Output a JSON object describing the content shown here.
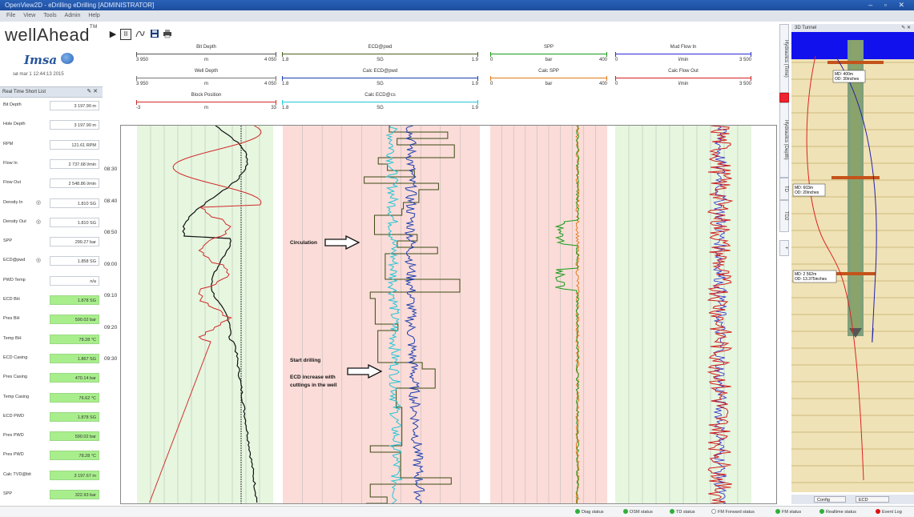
{
  "window": {
    "title": "OpenView2D - eDrilling eDrilling [ADMINISTRATOR]"
  },
  "menu": [
    "File",
    "View",
    "Tools",
    "Admin",
    "Help"
  ],
  "logo": {
    "text": "wellAhead",
    "mark": "TM"
  },
  "brand": {
    "text": "Imsa",
    "icon": "water-drop-icon"
  },
  "timestamp": "sø mar 1 12:44:13 2015",
  "short_list": {
    "title": "Real Time Short List",
    "items": [
      {
        "label": "Bit Depth",
        "value": "3 197.90 m",
        "green": false,
        "gauge": false
      },
      {
        "label": "Hole Depth",
        "value": "3 197.90 m",
        "green": false,
        "gauge": false
      },
      {
        "label": "RPM",
        "value": "121.61 RPM",
        "green": false,
        "gauge": false
      },
      {
        "label": "Flow In",
        "value": "2 737.68 l/min",
        "green": false,
        "gauge": false
      },
      {
        "label": "Flow Out",
        "value": "2 548.86 l/min",
        "green": false,
        "gauge": false
      },
      {
        "label": "Density In",
        "value": "1.810 SG",
        "green": false,
        "gauge": true
      },
      {
        "label": "Density Out",
        "value": "1.810 SG",
        "green": false,
        "gauge": true
      },
      {
        "label": "SPP",
        "value": "299.27 bar",
        "green": false,
        "gauge": false
      },
      {
        "label": "ECD@pwd",
        "value": "1.858 SG",
        "green": false,
        "gauge": true
      },
      {
        "label": "PWD Temp",
        "value": "n/a",
        "green": false,
        "gauge": false
      },
      {
        "label": "ECD BH",
        "value": "1.878 SG",
        "green": true,
        "gauge": false
      },
      {
        "label": "Pres BH",
        "value": "590.02 bar",
        "green": true,
        "gauge": false
      },
      {
        "label": "Temp BH",
        "value": "78.28 °C",
        "green": true,
        "gauge": false
      },
      {
        "label": "ECD Casing",
        "value": "1.867 SG",
        "green": true,
        "gauge": false
      },
      {
        "label": "Pres Casing",
        "value": "470.14 bar",
        "green": true,
        "gauge": false
      },
      {
        "label": "Temp Casing",
        "value": "76.62 °C",
        "green": true,
        "gauge": false
      },
      {
        "label": "ECD PWD",
        "value": "1.878 SG",
        "green": true,
        "gauge": false
      },
      {
        "label": "Pres PWD",
        "value": "590.02 bar",
        "green": true,
        "gauge": false
      },
      {
        "label": "Pres PWD",
        "value": "78.28 °C",
        "green": true,
        "gauge": false
      },
      {
        "label": "Calc TVD@bit",
        "value": "3 197.67 m",
        "green": true,
        "gauge": false
      },
      {
        "label": "SPP",
        "value": "322.93 bar",
        "green": true,
        "gauge": false
      }
    ]
  },
  "toolbar": {
    "play": "▶",
    "pause": "II"
  },
  "track_headers": [
    {
      "title": "Bit Depth",
      "min": "3 950",
      "unit": "m",
      "max": "4 050",
      "color": "#555555",
      "dashed": false
    },
    {
      "title": "Well Depth",
      "min": "3 950",
      "unit": "m",
      "max": "4 050",
      "color": "#777777",
      "dashed": true
    },
    {
      "title": "Block Position",
      "min": "-3",
      "unit": "m",
      "max": "33",
      "color": "#d22b2b",
      "dashed": false
    },
    {
      "title": "ECD@pwd",
      "min": "1.8",
      "unit": "SG",
      "max": "1.9",
      "color": "#4b5e1f",
      "dashed": false
    },
    {
      "title": "Calc ECD@pwd",
      "min": "1.8",
      "unit": "SG",
      "max": "1.9",
      "color": "#1c3fb0",
      "dashed": true
    },
    {
      "title": "Calc ECD@cs",
      "min": "1.8",
      "unit": "SG",
      "max": "1.9",
      "color": "#22c6d6",
      "dashed": true
    },
    {
      "title": "SPP",
      "min": "0",
      "unit": "bar",
      "max": "400",
      "color": "#1a9a1a",
      "dashed": false
    },
    {
      "title": "Calc SPP",
      "min": "0",
      "unit": "bar",
      "max": "400",
      "color": "#e07a1a",
      "dashed": false
    },
    {
      "title": "Mud Flow In",
      "min": "0",
      "unit": "l/min",
      "max": "3 500",
      "color": "#2a2ad0",
      "dashed": false
    },
    {
      "title": "Calc Flow Out",
      "min": "0",
      "unit": "l/min",
      "max": "3 500",
      "color": "#d02020",
      "dashed": false
    }
  ],
  "time_ticks": [
    "08:30",
    "08:40",
    "08:50",
    "09:00",
    "09:10",
    "09:20",
    "09:30"
  ],
  "annotations": {
    "circulation": "Circulation",
    "start_drilling": "Start drilling",
    "ecd_increase_1": "ECD increase with",
    "ecd_increase_2": "cuttings in the well"
  },
  "side_tabs": [
    "Hydraulics (Time)",
    "Hydraulics (Depth)",
    "TD",
    "TD2",
    "+"
  ],
  "tunnel": {
    "title": "3D Tunnel",
    "labels": [
      {
        "md": "MD: 400m",
        "od": "OD: 30inches"
      },
      {
        "md": "MD: 603m",
        "od": "OD: 20inches"
      },
      {
        "md": "MD: 2 562m",
        "od": "OD: 13.375inches"
      }
    ],
    "config_label": "Config",
    "ecd_label": "ECD"
  },
  "status": [
    {
      "label": "Diag status",
      "state": "ok"
    },
    {
      "label": "OSM status",
      "state": "ok"
    },
    {
      "label": "TD status",
      "state": "ok"
    },
    {
      "label": "FM Forward status",
      "state": "off"
    },
    {
      "label": "FM status",
      "state": "ok"
    },
    {
      "label": "Realtime status",
      "state": "ok"
    },
    {
      "label": "Event Log",
      "state": "alert"
    }
  ]
}
